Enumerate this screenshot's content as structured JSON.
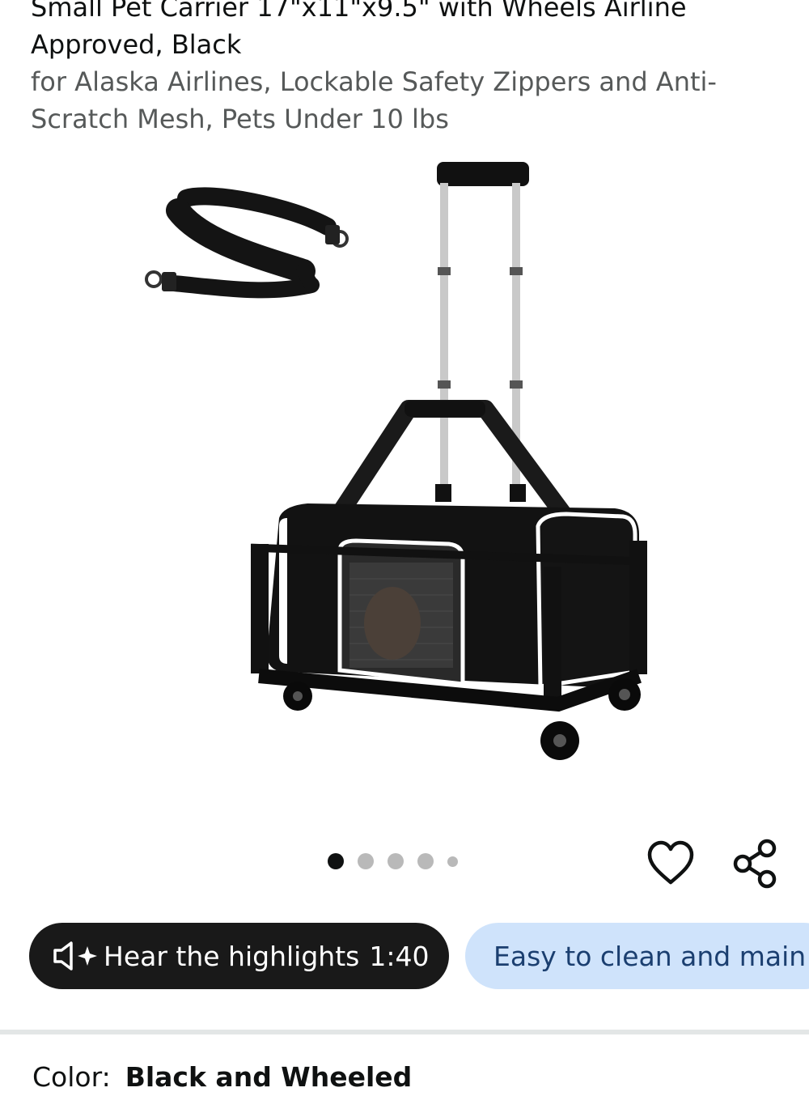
{
  "product": {
    "title_line1": "Small Pet Carrier 17\"x11\"x9.5\" with Wheels Airline",
    "title_line2": "Approved, Black",
    "subtitle_line1": "for Alaska Airlines, Lockable Safety Zippers and Anti-",
    "subtitle_line2": "Scratch Mesh, Pets Under 10 lbs",
    "image_icon": "rolling-pet-carrier-with-shoulder-strap"
  },
  "gallery": {
    "total_dots": 5,
    "active_index": 0
  },
  "actions": {
    "favorite_icon": "heart-icon",
    "share_icon": "share-icon"
  },
  "highlights": {
    "icon": "speaker-sparkle-icon",
    "label": "Hear the highlights",
    "duration": "1:40"
  },
  "chips": [
    {
      "label": "Easy to clean and main"
    }
  ],
  "color": {
    "label": "Color:",
    "value": "Black and Wheeled"
  },
  "colors": {
    "dark_pill": "#191919",
    "chip_bg": "#cfe3fb",
    "chip_text": "#1b3f70",
    "subtitle": "#565959"
  }
}
